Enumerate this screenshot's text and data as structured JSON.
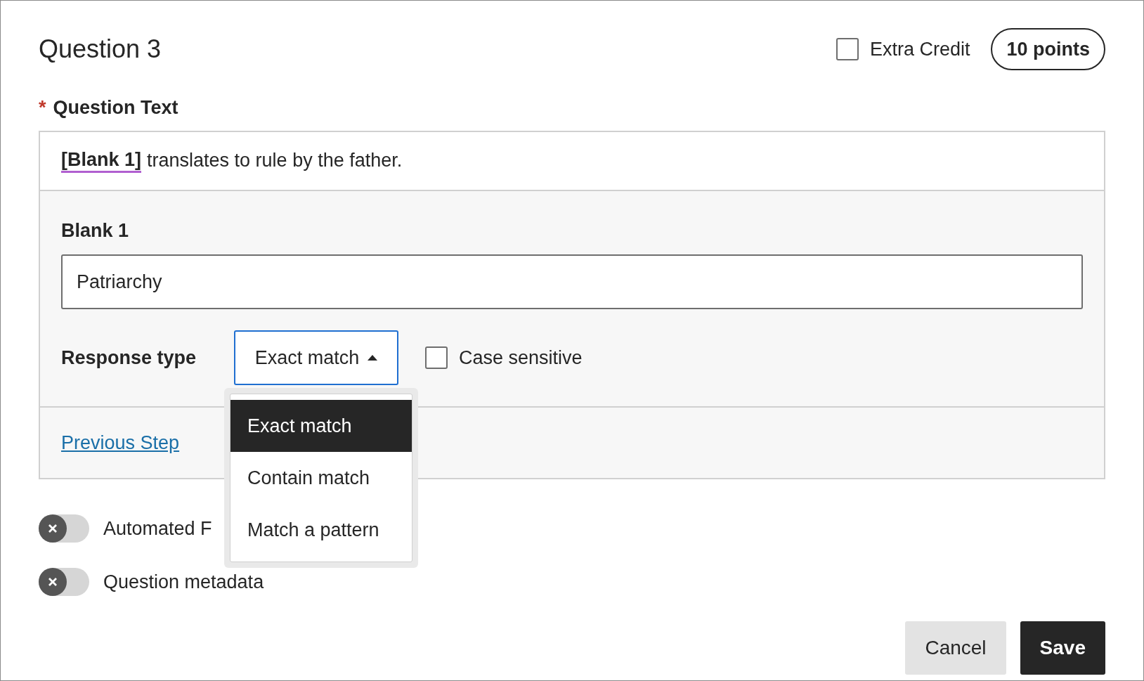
{
  "title": "Question 3",
  "extra_credit": {
    "label": "Extra Credit",
    "checked": false
  },
  "points": "10 points",
  "question_text": {
    "required_mark": "*",
    "label": "Question Text",
    "blank_tag": "[Blank 1]",
    "text": "translates to rule by the father."
  },
  "blank": {
    "label": "Blank 1",
    "value": "Patriarchy"
  },
  "response_type": {
    "label": "Response type",
    "value": "Exact match",
    "expanded": true,
    "options": [
      {
        "label": "Exact match",
        "selected": true
      },
      {
        "label": "Contain match",
        "selected": false
      },
      {
        "label": "Match a pattern",
        "selected": false
      }
    ]
  },
  "case_sensitive": {
    "label": "Case sensitive",
    "checked": false
  },
  "previous_step": "Previous Step",
  "toggles": [
    {
      "label": "Automated F",
      "on": false
    },
    {
      "label": "Question metadata",
      "on": false
    }
  ],
  "buttons": [
    {
      "label": "Cancel",
      "kind": "secondary"
    },
    {
      "label": "Save",
      "kind": "primary"
    }
  ]
}
